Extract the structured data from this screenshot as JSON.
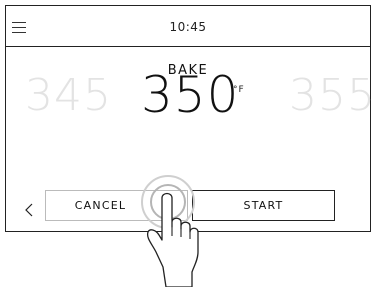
{
  "header": {
    "time": "10:45",
    "menu_icon": "hamburger-menu-icon"
  },
  "mode": {
    "label": "BAKE"
  },
  "temperature": {
    "previous": "345",
    "current": "350",
    "next": "355",
    "unit": "°F"
  },
  "actions": {
    "back_icon": "chevron-left-icon",
    "cancel_label": "CANCEL",
    "start_label": "START"
  },
  "overlay": {
    "hand_icon": "hand-tap-icon"
  }
}
